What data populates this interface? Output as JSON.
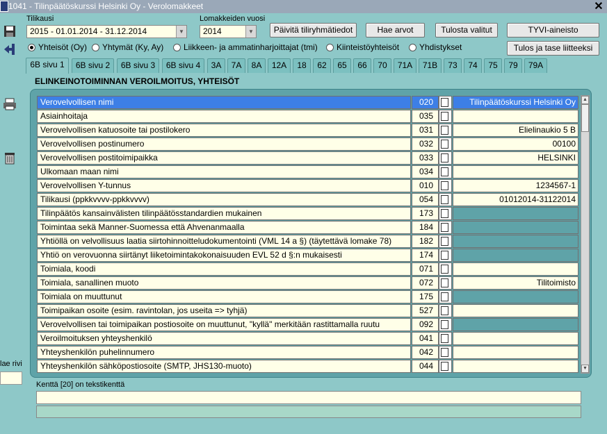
{
  "window": {
    "title": "1041 - Tilinpäätöskurssi Helsinki Oy - Verolomakkeet"
  },
  "left": {
    "label": "lae rivi"
  },
  "filters": {
    "period_label": "Tilikausi",
    "period_value": "2015 - 01.01.2014 - 31.12.2014",
    "year_label": "Lomakkeiden vuosi",
    "year_value": "2014"
  },
  "buttons": {
    "update": "Päivitä tiliryhmätiedot",
    "fetch": "Hae arvot",
    "print": "Tulosta valitut",
    "tyvi": "TYVI-aineisto",
    "report": "Tulos ja tase liitteeksi"
  },
  "radios": [
    {
      "label": "Yhteisöt (Oy)",
      "selected": true
    },
    {
      "label": "Yhtymät (Ky, Ay)",
      "selected": false
    },
    {
      "label": "Liikkeen- ja ammatinharjoittajat (tmi)",
      "selected": false
    },
    {
      "label": "Kiinteistöyhteisöt",
      "selected": false
    },
    {
      "label": "Yhdistykset",
      "selected": false
    }
  ],
  "tabs": [
    "6B sivu 1",
    "6B sivu 2",
    "6B sivu 3",
    "6B sivu 4",
    "3A",
    "7A",
    "8A",
    "12A",
    "18",
    "62",
    "65",
    "66",
    "70",
    "71A",
    "71B",
    "73",
    "74",
    "75",
    "79",
    "79A"
  ],
  "form": {
    "heading": "ELINKEINOTOIMINNAN VEROILMOITUS, YHTEISÖT"
  },
  "rows": [
    {
      "name": "Verovelvollisen nimi",
      "code": "020",
      "value": "Tilinpäätöskurssi Helsinki Oy",
      "teal": false,
      "dot": false
    },
    {
      "name": "Asiainhoitaja",
      "code": "035",
      "value": "",
      "teal": false,
      "dot": false
    },
    {
      "name": "Verovelvollisen katuosoite tai postilokero",
      "code": "031",
      "value": "Elielinaukio 5 B",
      "teal": false,
      "dot": false
    },
    {
      "name": "Verovelvollisen postinumero",
      "code": "032",
      "value": "00100",
      "teal": false,
      "dot": false
    },
    {
      "name": "Verovelvollisen postitoimipaikka",
      "code": "033",
      "value": "HELSINKI",
      "teal": false,
      "dot": false
    },
    {
      "name": "Ulkomaan maan nimi",
      "code": "034",
      "value": "",
      "teal": false,
      "dot": false
    },
    {
      "name": "Verovelvollisen Y-tunnus",
      "code": "010",
      "value": "1234567-1",
      "teal": false,
      "dot": false
    },
    {
      "name": "Tilikausi (ppkkvvvv-ppkkvvvv)",
      "code": "054",
      "value": "01012014-31122014",
      "teal": false,
      "dot": false
    },
    {
      "name": "Tilinpäätös kansainvälisten tilinpäätösstandardien mukainen",
      "code": "173",
      "value": "",
      "teal": true,
      "dot": true
    },
    {
      "name": "Toimintaa sekä Manner-Suomessa että Ahvenanmaalla",
      "code": "184",
      "value": "",
      "teal": true,
      "dot": true
    },
    {
      "name": "Yhtiöllä on velvollisuus laatia siirtohinnoitteludokumentointi (VML 14 a §) (täytettävä lomake 78)",
      "code": "182",
      "value": "",
      "teal": true,
      "dot": true
    },
    {
      "name": "Yhtiö on verovuonna siirtänyt liiketoimintakokonaisuuden EVL 52 d §:n mukaisesti",
      "code": "174",
      "value": "",
      "teal": true,
      "dot": true
    },
    {
      "name": "Toimiala, koodi",
      "code": "071",
      "value": "",
      "teal": false,
      "dot": false
    },
    {
      "name": "Toimiala, sanallinen muoto",
      "code": "072",
      "value": "Tilitoimisto",
      "teal": false,
      "dot": false
    },
    {
      "name": "Toimiala on muuttunut",
      "code": "175",
      "value": "",
      "teal": true,
      "dot": true
    },
    {
      "name": "Toimipaikan osoite (esim. ravintolan,  jos useita => tyhjä)",
      "code": "527",
      "value": "",
      "teal": false,
      "dot": false
    },
    {
      "name": "Verovelvollisen tai toimipaikan postiosoite on muuttunut, \"kyllä\" merkitään rastittamalla ruutu",
      "code": "092",
      "value": "",
      "teal": true,
      "dot": true
    },
    {
      "name": "Veroilmoituksen yhteyshenkilö",
      "code": "041",
      "value": "",
      "teal": false,
      "dot": false
    },
    {
      "name": "Yhteyshenkilön puhelinnumero",
      "code": "042",
      "value": "",
      "teal": false,
      "dot": false
    },
    {
      "name": "Yhteyshenkilön sähköpostiosoite (SMTP, JHS130-muoto)",
      "code": "044",
      "value": "",
      "teal": false,
      "dot": false
    }
  ],
  "status": {
    "label": "Kenttä [20] on tekstikenttä"
  }
}
